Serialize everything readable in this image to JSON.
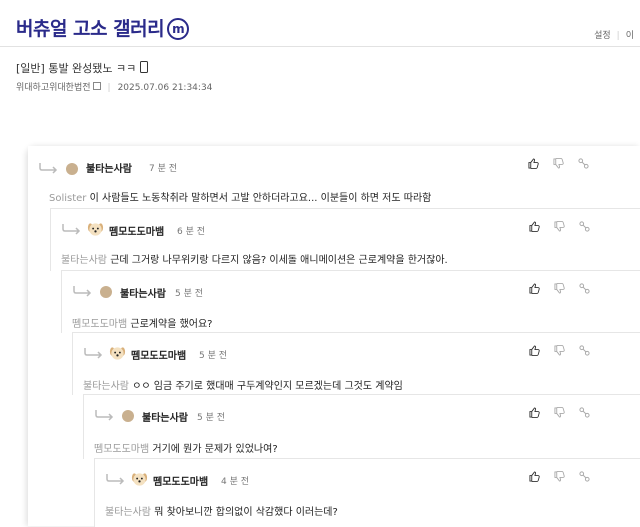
{
  "header": {
    "gallery_title": "버츄얼 고소 갤러리",
    "badge": "m",
    "links": [
      "설정",
      "|",
      "이"
    ]
  },
  "post": {
    "title": "[일반] 통발 완성됐노 ㅋㅋ",
    "author": "위대하고위대한법전",
    "datetime": "2025.07.06 21:34:34"
  },
  "comments": [
    {
      "nick": "불타는사람",
      "avatar": "dot",
      "time": "7 분 전",
      "mention": "Solister",
      "text": "이 사람들도 노동착취라 말하면서 고발 안하더라고요... 이분들이 하면 저도 따라함"
    },
    {
      "nick": "뗌모도도마뱀",
      "avatar": "dog",
      "time": "6 분 전",
      "mention": "불타는사람",
      "text": "근데 그거랑 나무위키랑 다르지 않음? 이세돌 애니메이션은 근로계약을 한거잖아."
    },
    {
      "nick": "불타는사람",
      "avatar": "dot",
      "time": "5 분 전",
      "mention": "뗌모도도마뱀",
      "text": "근로계약을 했어요?"
    },
    {
      "nick": "뗌모도도마뱀",
      "avatar": "dog",
      "time": "5 분 전",
      "mention": "불타는사람",
      "text": "ㅇㅇ 임금 주기로 했대매 구두계약인지 모르겠는데 그것도 계약임"
    },
    {
      "nick": "불타는사람",
      "avatar": "dot",
      "time": "5 분 전",
      "mention": "뗌모도도마뱀",
      "text": "거기에 뭔가 문제가 있었나여?"
    },
    {
      "nick": "뗌모도도마뱀",
      "avatar": "dog",
      "time": "4 분 전",
      "mention": "불타는사람",
      "text": "뭐 찾아보니깐 합의없이 삭감했다 이러는데?"
    }
  ],
  "icons": {
    "like": "thumbs-up-icon",
    "dislike": "thumbs-down-icon",
    "share": "link-icon",
    "reply": "reply-arrow-icon"
  }
}
